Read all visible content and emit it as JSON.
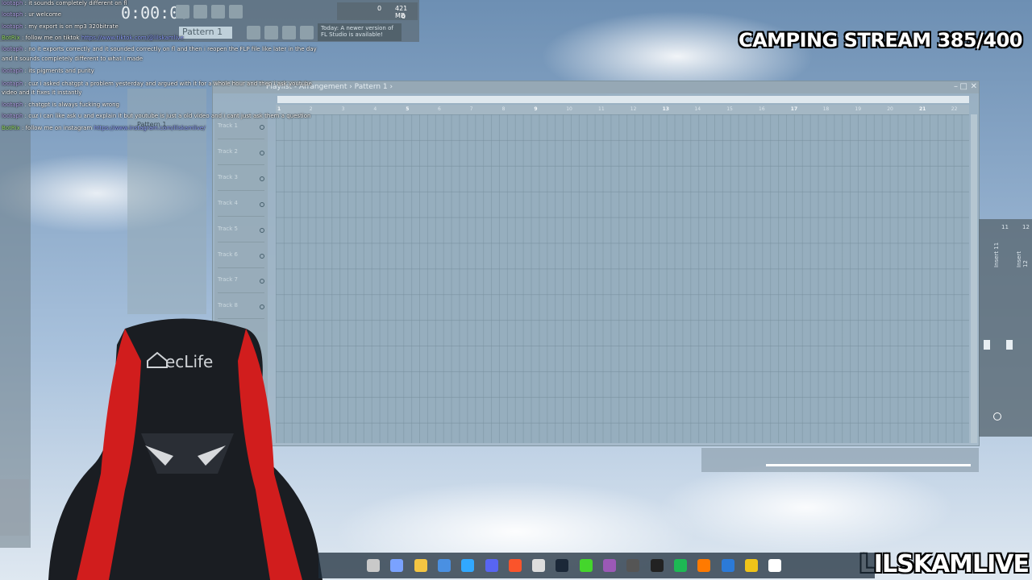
{
  "stream": {
    "title": "CAMPING STREAM 385/400",
    "channel": "LILSKAMLIVE"
  },
  "fl_toolbar": {
    "time": "0:00:00",
    "pattern": "Pattern 1",
    "hint": "Today: A newer version of FL Studio is available!",
    "mem_value": "421 MB",
    "cpu_value": "0",
    "voices": "0"
  },
  "chat": [
    {
      "user": "lootaph",
      "text": "it sounds completely different on fl"
    },
    {
      "user": "lootaph",
      "text": "ur welcome"
    },
    {
      "user": "lootaph",
      "text": "my export is on mp3 320bitrate"
    },
    {
      "user": "BotRix",
      "text": "follow me on tiktok",
      "link": "https://www.tiktok.com/@lilskamlive"
    },
    {
      "user": "lootaph",
      "text": "no it exports correctly and it sounded correctly on fl and then i reopen the FLP file like later in the day"
    },
    {
      "user": "",
      "text": "and it sounds completely different to what i made"
    },
    {
      "user": "lootaph",
      "text": "its pigments and purity"
    },
    {
      "user": "lootaph",
      "text": "cuz i asked chatgpt a problem yesterday and argued with it for a whole hour and then i ask youtube"
    },
    {
      "user": "",
      "text": "video and it fixes it instantly"
    },
    {
      "user": "lootaph",
      "text": "chatgpt is always fucking wrong"
    },
    {
      "user": "lootaph",
      "text": "cuz i can like ask u and explain it but youtube is just a old video and i cant just ask them a question"
    },
    {
      "user": "BotRix",
      "text": "follow me on instagram",
      "link": "https://www.instagram.com/lilskamlive/"
    }
  ],
  "playlist": {
    "title": "Playlist - Arrangement › Pattern 1 ›",
    "tracks": [
      "Track 1",
      "Track 2",
      "Track 3",
      "Track 4",
      "Track 5",
      "Track 6",
      "Track 7",
      "Track 8"
    ],
    "ruler": [
      "1",
      "2",
      "3",
      "4",
      "5",
      "6",
      "7",
      "8",
      "9",
      "10",
      "11",
      "12",
      "13",
      "14",
      "15",
      "16",
      "17",
      "18",
      "19",
      "20",
      "21",
      "22"
    ]
  },
  "browser": {
    "pattern_label": "Pattern 1"
  },
  "mixer": {
    "insert_labels": [
      "Insert 11",
      "Insert 12"
    ],
    "numbers": [
      "11",
      "12"
    ]
  },
  "chair_brand": "ecLife",
  "taskbar_icons": [
    "photos-icon",
    "copilot-icon",
    "file-explorer-icon",
    "store-icon",
    "photoshop-icon",
    "discord-icon",
    "brave-icon",
    "obs-icon",
    "steam-icon",
    "razer-icon",
    "winrar-icon",
    "4k-downloader-icon",
    "capcut-icon",
    "spotify-icon",
    "fl-studio-icon",
    "notepad-icon",
    "explorer-icon",
    "file-icon"
  ],
  "colors": {
    "chat_user": "#b9a8f0",
    "bot_user": "#9be36d",
    "playlist_bg": "#96aebe"
  }
}
